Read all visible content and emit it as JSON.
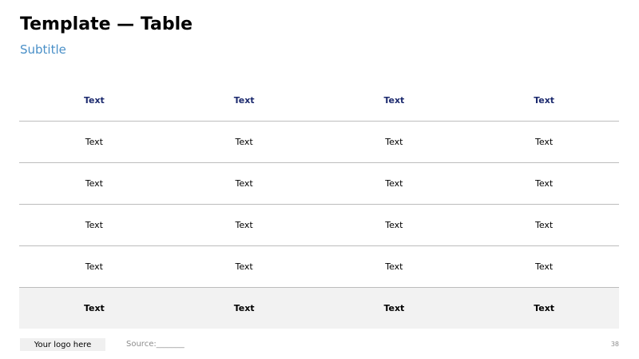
{
  "slide": {
    "title": "Template — Table",
    "subtitle": "Subtitle",
    "page_number": "38"
  },
  "table": {
    "headers": [
      "Text",
      "Text",
      "Text",
      "Text"
    ],
    "rows": [
      [
        "Text",
        "Text",
        "Text",
        "Text"
      ],
      [
        "Text",
        "Text",
        "Text",
        "Text"
      ],
      [
        "Text",
        "Text",
        "Text",
        "Text"
      ],
      [
        "Text",
        "Text",
        "Text",
        "Text"
      ]
    ],
    "total_row": [
      "Text",
      "Text",
      "Text",
      "Text"
    ]
  },
  "footer": {
    "logo_text": "Your logo here",
    "source_text": "Source:_______"
  },
  "colors": {
    "header_text": "#1c2a6e",
    "subtitle": "#4a90c8",
    "total_row_bg": "#f2f2f2"
  }
}
